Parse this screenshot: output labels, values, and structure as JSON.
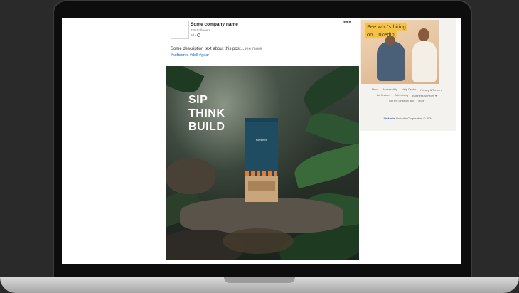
{
  "post": {
    "company_name": "Some company name",
    "followers": "328 Followers",
    "time": "3d •",
    "more_menu": "•••",
    "description": "Some description text about this post...",
    "see_more": "see more",
    "hashtags": "#softserve #dell #gear",
    "image_text": [
      "SIP",
      "THINK",
      "BUILD"
    ],
    "product_brand": "softserve"
  },
  "sidebar": {
    "ad_lines": [
      "See who's hiring",
      "on LinkedIn."
    ],
    "footer_links": [
      "About",
      "Accessibility",
      "Help Center",
      "Privacy & Terms ▾",
      "Ad Choices",
      "Advertising",
      "Business Services ▾",
      "Get the LinkedIn app",
      "More"
    ],
    "brand": "Linked",
    "brand_suffix": "in",
    "copyright": "LinkedIn Corporation © 2024"
  },
  "colors": {
    "link": "#0a66c2",
    "accent": "#f6c244",
    "laptop_bezel": "#0d0d0d",
    "background": "#2a2a2a"
  }
}
